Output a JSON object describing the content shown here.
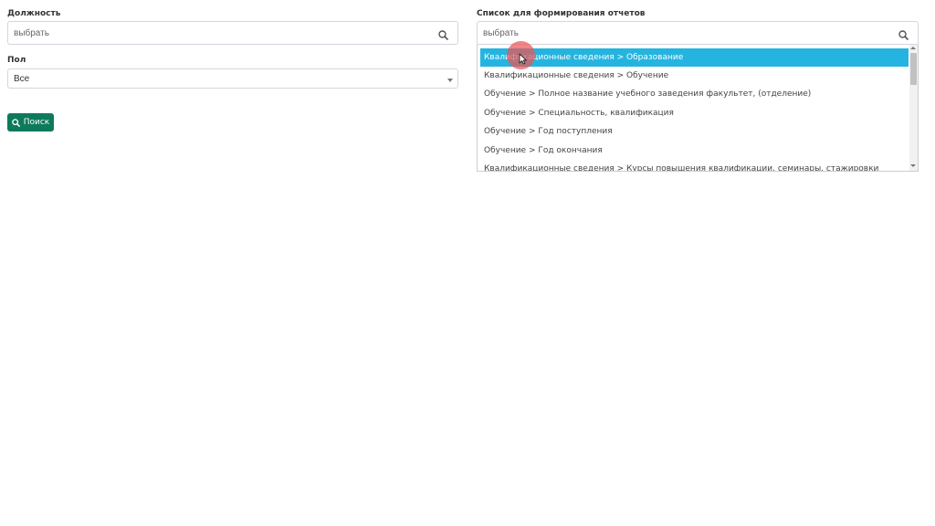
{
  "position_filter": {
    "label": "Должность",
    "placeholder": "выбрать",
    "search_icon": "search-icon"
  },
  "gender_filter": {
    "label": "Пол",
    "selected": "Все",
    "caret_icon": "chevron-down-icon"
  },
  "search_button": {
    "label": "Поиск",
    "icon": "search-icon",
    "color": "#0d7a5c"
  },
  "report_list": {
    "label": "Список для формирования отчетов",
    "placeholder": "выбрать",
    "search_icon": "search-icon",
    "highlight_color": "#25b4df",
    "options": [
      {
        "label": "Квалификационные сведения > Образование",
        "active": true
      },
      {
        "label": "Квалификационные сведения > Обучение",
        "active": false
      },
      {
        "label": "Обучение > Полное название учебного заведения факультет, (отделение)",
        "active": false
      },
      {
        "label": "Обучение > Специальность, квалификация",
        "active": false
      },
      {
        "label": "Обучение > Год поступления",
        "active": false
      },
      {
        "label": "Обучение > Год окончания",
        "active": false
      },
      {
        "label": "Квалификационные сведения > Курсы повышения квалификации, семинары, стажировки",
        "active": false
      }
    ]
  }
}
